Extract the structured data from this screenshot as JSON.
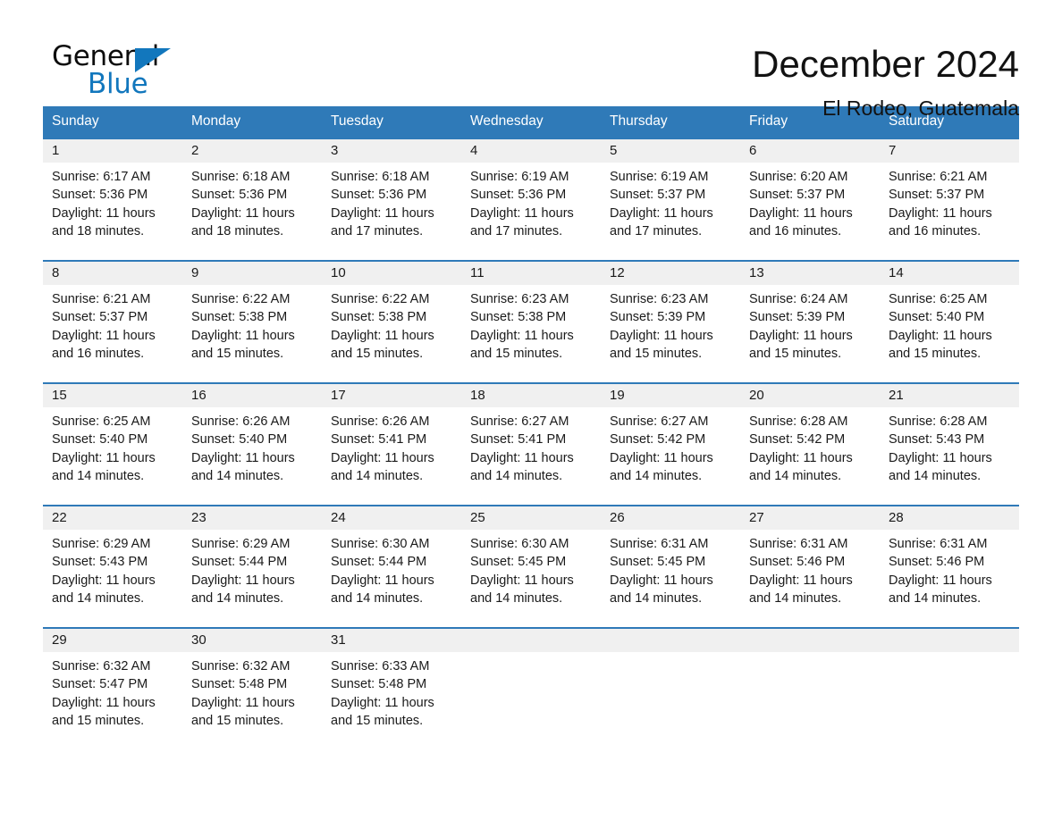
{
  "brand": {
    "name_part1": "General",
    "name_part2": "Blue",
    "triangle_color": "#1277bd"
  },
  "header": {
    "title": "December 2024",
    "subtitle": "El Rodeo, Guatemala"
  },
  "theme": {
    "header_blue": "#2f7ab8",
    "band_gray": "#f0f0f0",
    "text": "#1a1a1a"
  },
  "calendar": {
    "weekday_headers": [
      "Sunday",
      "Monday",
      "Tuesday",
      "Wednesday",
      "Thursday",
      "Friday",
      "Saturday"
    ],
    "weeks": [
      [
        {
          "day": "1",
          "detail": "Sunrise: 6:17 AM\nSunset: 5:36 PM\nDaylight: 11 hours\nand 18 minutes."
        },
        {
          "day": "2",
          "detail": "Sunrise: 6:18 AM\nSunset: 5:36 PM\nDaylight: 11 hours\nand 18 minutes."
        },
        {
          "day": "3",
          "detail": "Sunrise: 6:18 AM\nSunset: 5:36 PM\nDaylight: 11 hours\nand 17 minutes."
        },
        {
          "day": "4",
          "detail": "Sunrise: 6:19 AM\nSunset: 5:36 PM\nDaylight: 11 hours\nand 17 minutes."
        },
        {
          "day": "5",
          "detail": "Sunrise: 6:19 AM\nSunset: 5:37 PM\nDaylight: 11 hours\nand 17 minutes."
        },
        {
          "day": "6",
          "detail": "Sunrise: 6:20 AM\nSunset: 5:37 PM\nDaylight: 11 hours\nand 16 minutes."
        },
        {
          "day": "7",
          "detail": "Sunrise: 6:21 AM\nSunset: 5:37 PM\nDaylight: 11 hours\nand 16 minutes."
        }
      ],
      [
        {
          "day": "8",
          "detail": "Sunrise: 6:21 AM\nSunset: 5:37 PM\nDaylight: 11 hours\nand 16 minutes."
        },
        {
          "day": "9",
          "detail": "Sunrise: 6:22 AM\nSunset: 5:38 PM\nDaylight: 11 hours\nand 15 minutes."
        },
        {
          "day": "10",
          "detail": "Sunrise: 6:22 AM\nSunset: 5:38 PM\nDaylight: 11 hours\nand 15 minutes."
        },
        {
          "day": "11",
          "detail": "Sunrise: 6:23 AM\nSunset: 5:38 PM\nDaylight: 11 hours\nand 15 minutes."
        },
        {
          "day": "12",
          "detail": "Sunrise: 6:23 AM\nSunset: 5:39 PM\nDaylight: 11 hours\nand 15 minutes."
        },
        {
          "day": "13",
          "detail": "Sunrise: 6:24 AM\nSunset: 5:39 PM\nDaylight: 11 hours\nand 15 minutes."
        },
        {
          "day": "14",
          "detail": "Sunrise: 6:25 AM\nSunset: 5:40 PM\nDaylight: 11 hours\nand 15 minutes."
        }
      ],
      [
        {
          "day": "15",
          "detail": "Sunrise: 6:25 AM\nSunset: 5:40 PM\nDaylight: 11 hours\nand 14 minutes."
        },
        {
          "day": "16",
          "detail": "Sunrise: 6:26 AM\nSunset: 5:40 PM\nDaylight: 11 hours\nand 14 minutes."
        },
        {
          "day": "17",
          "detail": "Sunrise: 6:26 AM\nSunset: 5:41 PM\nDaylight: 11 hours\nand 14 minutes."
        },
        {
          "day": "18",
          "detail": "Sunrise: 6:27 AM\nSunset: 5:41 PM\nDaylight: 11 hours\nand 14 minutes."
        },
        {
          "day": "19",
          "detail": "Sunrise: 6:27 AM\nSunset: 5:42 PM\nDaylight: 11 hours\nand 14 minutes."
        },
        {
          "day": "20",
          "detail": "Sunrise: 6:28 AM\nSunset: 5:42 PM\nDaylight: 11 hours\nand 14 minutes."
        },
        {
          "day": "21",
          "detail": "Sunrise: 6:28 AM\nSunset: 5:43 PM\nDaylight: 11 hours\nand 14 minutes."
        }
      ],
      [
        {
          "day": "22",
          "detail": "Sunrise: 6:29 AM\nSunset: 5:43 PM\nDaylight: 11 hours\nand 14 minutes."
        },
        {
          "day": "23",
          "detail": "Sunrise: 6:29 AM\nSunset: 5:44 PM\nDaylight: 11 hours\nand 14 minutes."
        },
        {
          "day": "24",
          "detail": "Sunrise: 6:30 AM\nSunset: 5:44 PM\nDaylight: 11 hours\nand 14 minutes."
        },
        {
          "day": "25",
          "detail": "Sunrise: 6:30 AM\nSunset: 5:45 PM\nDaylight: 11 hours\nand 14 minutes."
        },
        {
          "day": "26",
          "detail": "Sunrise: 6:31 AM\nSunset: 5:45 PM\nDaylight: 11 hours\nand 14 minutes."
        },
        {
          "day": "27",
          "detail": "Sunrise: 6:31 AM\nSunset: 5:46 PM\nDaylight: 11 hours\nand 14 minutes."
        },
        {
          "day": "28",
          "detail": "Sunrise: 6:31 AM\nSunset: 5:46 PM\nDaylight: 11 hours\nand 14 minutes."
        }
      ],
      [
        {
          "day": "29",
          "detail": "Sunrise: 6:32 AM\nSunset: 5:47 PM\nDaylight: 11 hours\nand 15 minutes."
        },
        {
          "day": "30",
          "detail": "Sunrise: 6:32 AM\nSunset: 5:48 PM\nDaylight: 11 hours\nand 15 minutes."
        },
        {
          "day": "31",
          "detail": "Sunrise: 6:33 AM\nSunset: 5:48 PM\nDaylight: 11 hours\nand 15 minutes."
        },
        {
          "day": "",
          "detail": ""
        },
        {
          "day": "",
          "detail": ""
        },
        {
          "day": "",
          "detail": ""
        },
        {
          "day": "",
          "detail": ""
        }
      ]
    ]
  }
}
